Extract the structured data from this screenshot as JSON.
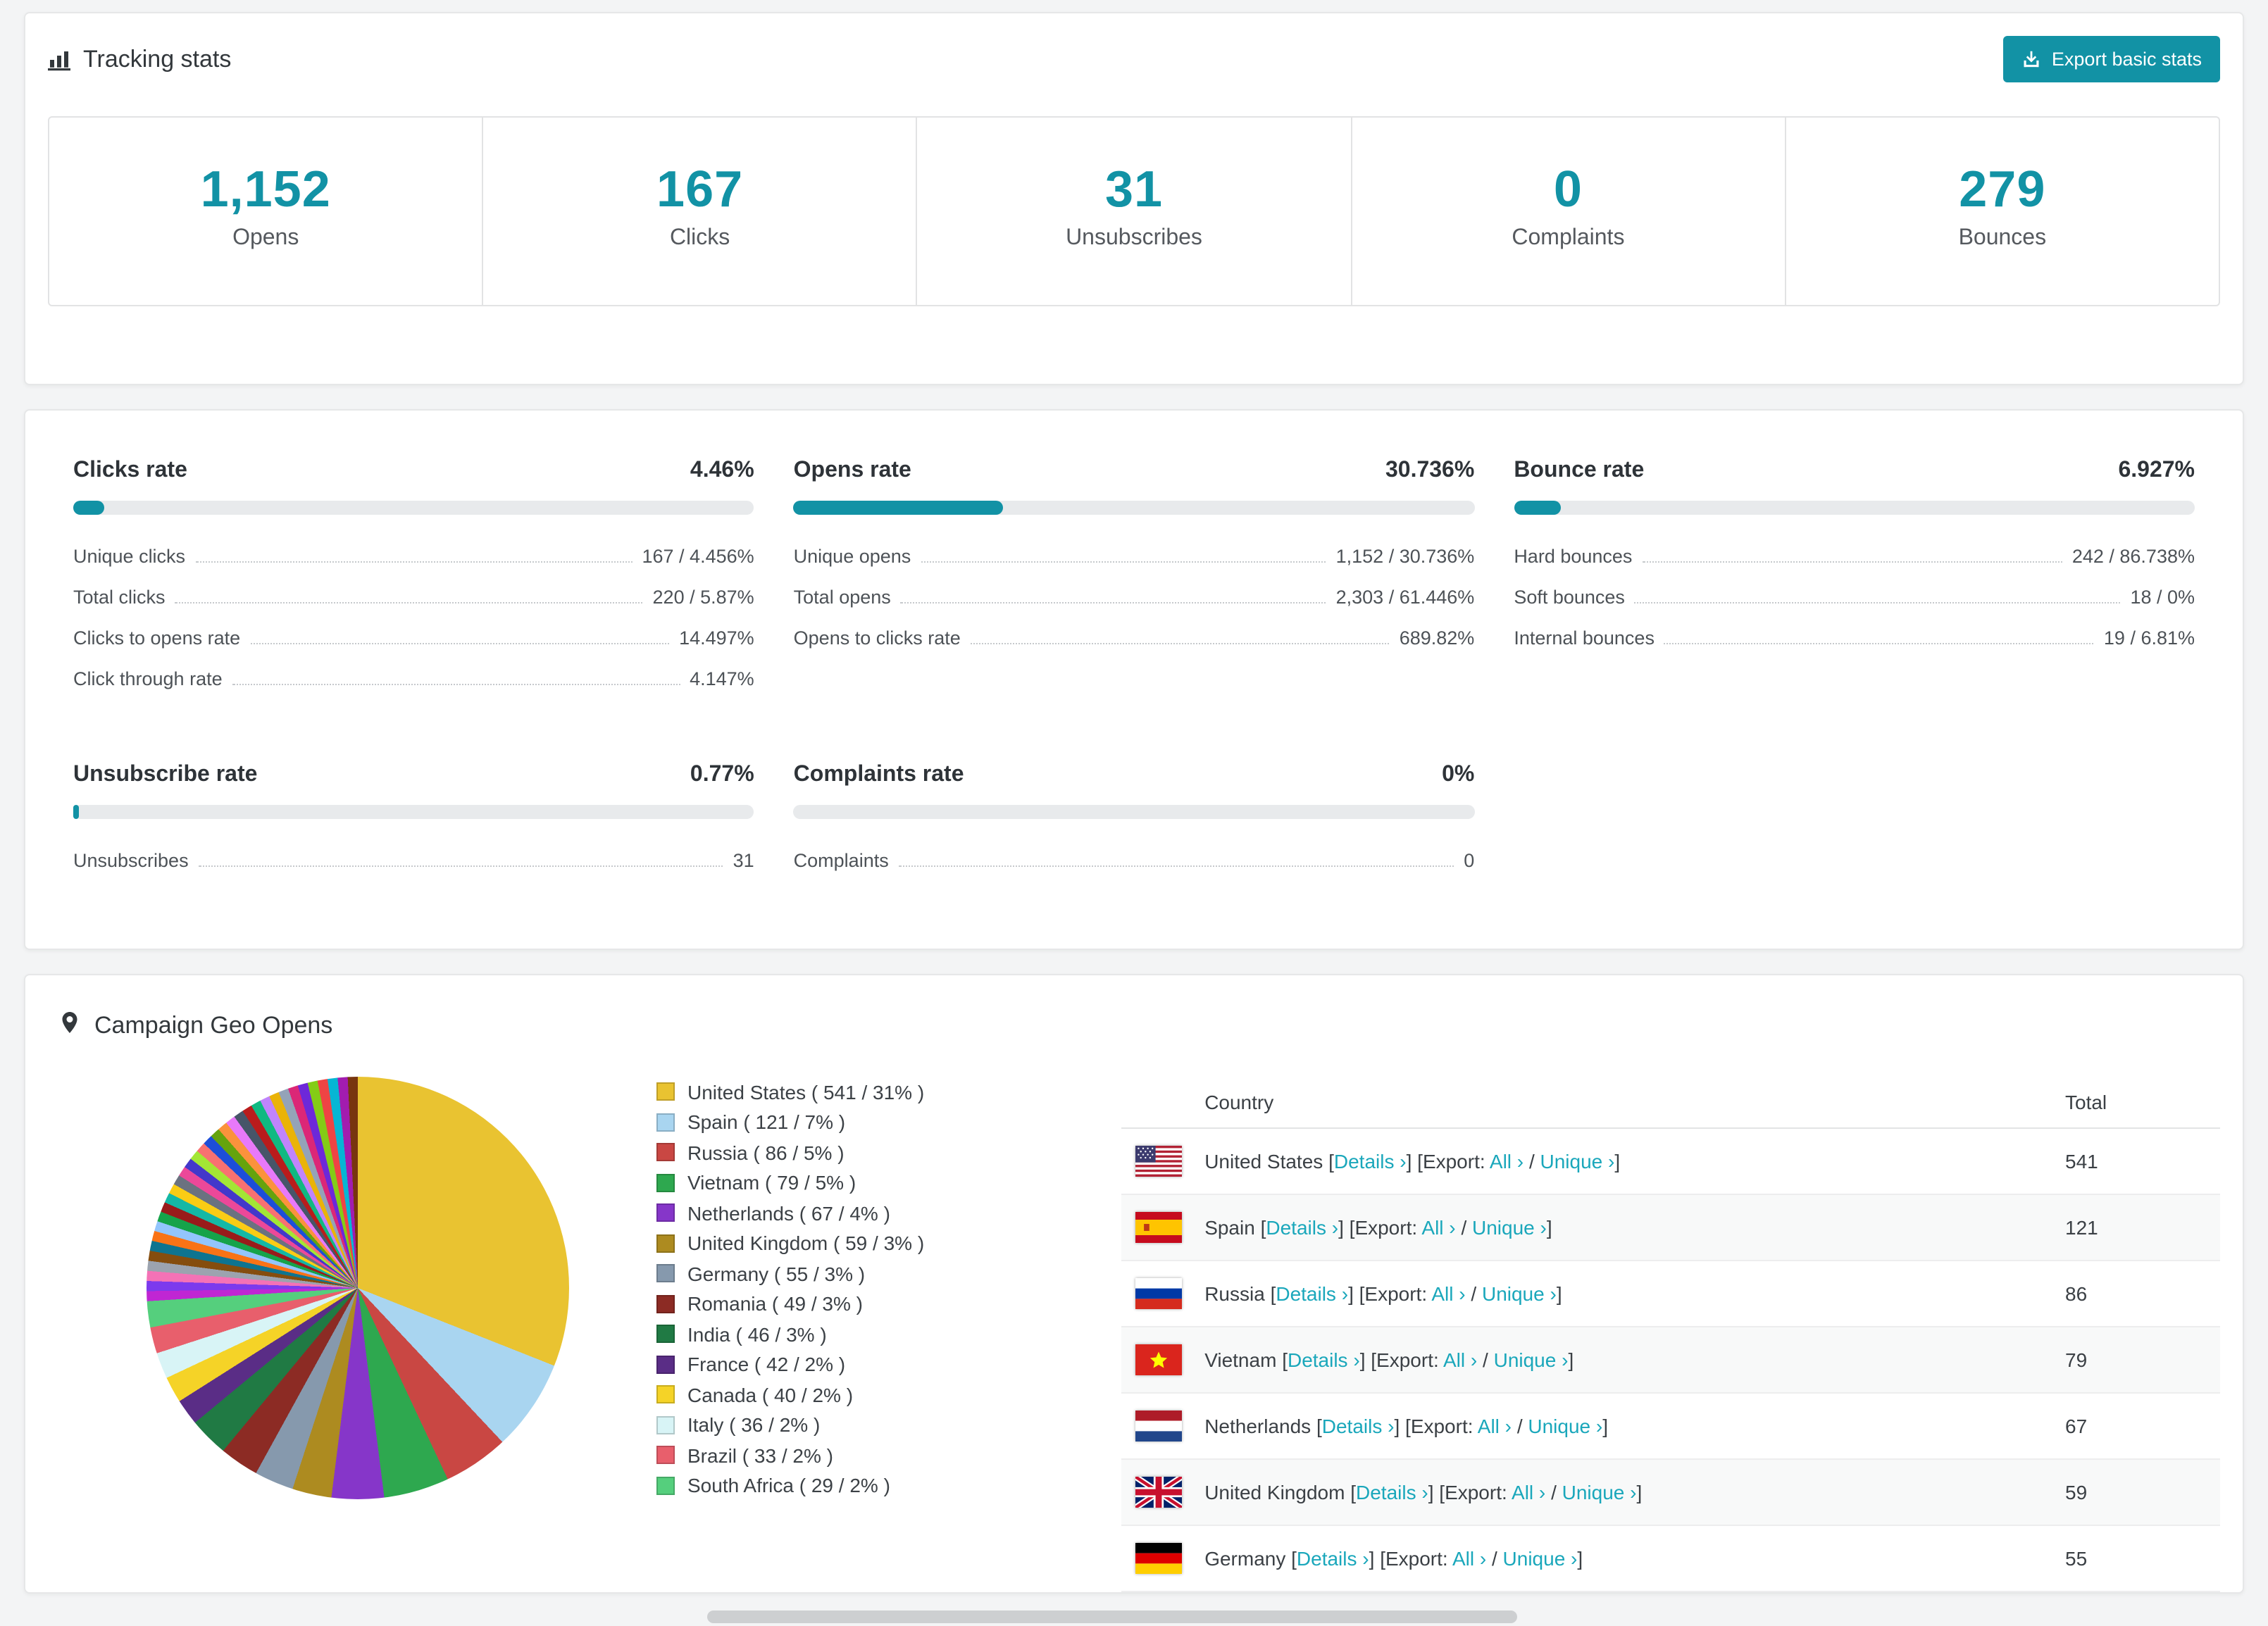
{
  "colors": {
    "accent": "#1292a5",
    "link": "#1aa7bb"
  },
  "icons": {
    "header": "bar-chart-icon",
    "export": "export-icon",
    "geo": "map-pin-icon"
  },
  "tracking": {
    "title": "Tracking stats",
    "export_button": "Export basic stats",
    "stats": [
      {
        "value": "1,152",
        "label": "Opens"
      },
      {
        "value": "167",
        "label": "Clicks"
      },
      {
        "value": "31",
        "label": "Unsubscribes"
      },
      {
        "value": "0",
        "label": "Complaints"
      },
      {
        "value": "279",
        "label": "Bounces"
      }
    ]
  },
  "rates": {
    "clicks": {
      "title": "Clicks rate",
      "value": "4.46%",
      "bar_percent": 4.46,
      "rows": [
        {
          "label": "Unique clicks",
          "value": "167 / 4.456%"
        },
        {
          "label": "Total clicks",
          "value": "220 / 5.87%"
        },
        {
          "label": "Clicks to opens rate",
          "value": "14.497%"
        },
        {
          "label": "Click through rate",
          "value": "4.147%"
        }
      ]
    },
    "opens": {
      "title": "Opens rate",
      "value": "30.736%",
      "bar_percent": 30.736,
      "rows": [
        {
          "label": "Unique opens",
          "value": "1,152 / 30.736%"
        },
        {
          "label": "Total opens",
          "value": "2,303 / 61.446%"
        },
        {
          "label": "Opens to clicks rate",
          "value": "689.82%"
        }
      ]
    },
    "bounce": {
      "title": "Bounce rate",
      "value": "6.927%",
      "bar_percent": 6.927,
      "rows": [
        {
          "label": "Hard bounces",
          "value": "242 / 86.738%"
        },
        {
          "label": "Soft bounces",
          "value": "18 / 0%"
        },
        {
          "label": "Internal bounces",
          "value": "19 / 6.81%"
        }
      ]
    },
    "unsubscribe": {
      "title": "Unsubscribe rate",
      "value": "0.77%",
      "bar_percent": 0.77,
      "rows": [
        {
          "label": "Unsubscribes",
          "value": "31"
        }
      ]
    },
    "complaints": {
      "title": "Complaints rate",
      "value": "0%",
      "bar_percent": 0,
      "rows": [
        {
          "label": "Complaints",
          "value": "0"
        }
      ]
    }
  },
  "geo": {
    "title": "Campaign Geo Opens",
    "table_headers": {
      "country": "Country",
      "total": "Total"
    },
    "link_labels": {
      "open": "[",
      "close": "]",
      "details": "Details ›",
      "export": "Export:",
      "all": "All ›",
      "slash": "/",
      "unique": "Unique ›"
    },
    "rows": [
      {
        "country": "United States",
        "flag": "us",
        "total": "541"
      },
      {
        "country": "Spain",
        "flag": "es",
        "total": "121"
      },
      {
        "country": "Russia",
        "flag": "ru",
        "total": "86"
      },
      {
        "country": "Vietnam",
        "flag": "vn",
        "total": "79"
      },
      {
        "country": "Netherlands",
        "flag": "nl",
        "total": "67"
      },
      {
        "country": "United Kingdom",
        "flag": "gb",
        "total": "59"
      },
      {
        "country": "Germany",
        "flag": "de",
        "total": "55"
      }
    ]
  },
  "chart_data": {
    "type": "pie",
    "title": "Campaign Geo Opens",
    "legend_position": "right",
    "slices": [
      {
        "label": "United States",
        "value": 541,
        "percent": 31,
        "color": "#e9c331"
      },
      {
        "label": "Spain",
        "value": 121,
        "percent": 7,
        "color": "#a9d5f0"
      },
      {
        "label": "Russia",
        "value": 86,
        "percent": 5,
        "color": "#c94743"
      },
      {
        "label": "Vietnam",
        "value": 79,
        "percent": 5,
        "color": "#2ea84f"
      },
      {
        "label": "Netherlands",
        "value": 67,
        "percent": 4,
        "color": "#8636c9"
      },
      {
        "label": "United Kingdom",
        "value": 59,
        "percent": 3,
        "color": "#ad8b20"
      },
      {
        "label": "Germany",
        "value": 55,
        "percent": 3,
        "color": "#8699ad"
      },
      {
        "label": "Romania",
        "value": 49,
        "percent": 3,
        "color": "#8c2b24"
      },
      {
        "label": "India",
        "value": 46,
        "percent": 3,
        "color": "#207a44"
      },
      {
        "label": "France",
        "value": 42,
        "percent": 2,
        "color": "#5a2d86"
      },
      {
        "label": "Canada",
        "value": 40,
        "percent": 2,
        "color": "#f5d327"
      },
      {
        "label": "Italy",
        "value": 36,
        "percent": 2,
        "color": "#d8f4f6"
      },
      {
        "label": "Brazil",
        "value": 33,
        "percent": 2,
        "color": "#e85f6c"
      },
      {
        "label": "South Africa",
        "value": 29,
        "percent": 2,
        "color": "#55cf7d"
      }
    ],
    "other_slices": {
      "total_percent": 26,
      "colors": [
        "#c026d3",
        "#7c3aed",
        "#f472b6",
        "#9ca3af",
        "#854d0e",
        "#0e7490",
        "#f97316",
        "#93c5fd",
        "#16a34a",
        "#991b1b",
        "#14b8a6",
        "#facc15",
        "#6b7280",
        "#ec4899",
        "#4338ca",
        "#a3e635",
        "#f87171",
        "#1d4ed8",
        "#65a30d",
        "#fb923c",
        "#e879f9",
        "#475569",
        "#b91c1c",
        "#10b981",
        "#c084fc",
        "#eab308",
        "#94a3b8",
        "#db2777",
        "#6d28d9",
        "#84cc16",
        "#ef4444",
        "#06b6d4",
        "#a21caf",
        "#78350f"
      ]
    }
  }
}
